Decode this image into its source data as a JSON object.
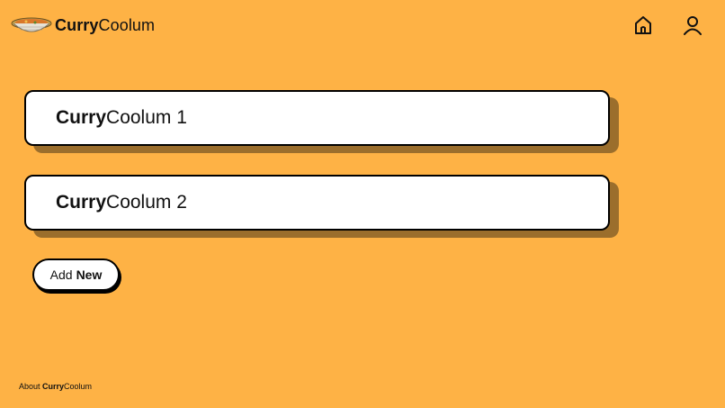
{
  "header": {
    "brand_bold": "Curry",
    "brand_regular": "Coolum",
    "logo_icon": "curry-bowl-icon",
    "nav_icons": [
      "home-icon",
      "user-icon"
    ]
  },
  "cards": [
    {
      "bold": "Curry",
      "regular": "Coolum 1"
    },
    {
      "bold": "Curry",
      "regular": "Coolum 2"
    }
  ],
  "add_button": {
    "regular": "Add",
    "bold": "New"
  },
  "footer": {
    "prefix": "About ",
    "bold": "Curry",
    "regular": "Coolum"
  },
  "colors": {
    "background": "#FEB245",
    "card_shadow": "#9B6E2C",
    "card_bg": "#FFFFFF",
    "text": "#111111"
  }
}
